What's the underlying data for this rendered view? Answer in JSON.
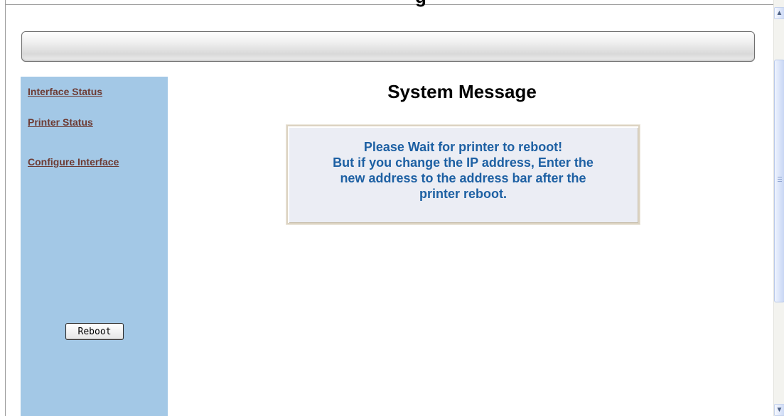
{
  "header": {
    "partial_title": "g"
  },
  "sidebar": {
    "links": [
      {
        "label": "Interface Status"
      },
      {
        "label": "Printer Status"
      },
      {
        "label": "Configure Interface"
      }
    ],
    "reboot_label": "Reboot"
  },
  "main": {
    "title": "System Message",
    "message": {
      "line1": "Please Wait for printer to reboot!",
      "line2": "But if you change the IP address, Enter the",
      "line3": "new address to the address bar after the",
      "line4": "printer reboot."
    }
  },
  "scrollbar": {
    "up_icon": "chevron-up-icon",
    "down_icon": "chevron-down-icon"
  },
  "colors": {
    "sidebar_bg": "#a3c8e6",
    "link_color": "#6d3b34",
    "message_text": "#1d60a3",
    "message_bg": "#ebedf4"
  }
}
